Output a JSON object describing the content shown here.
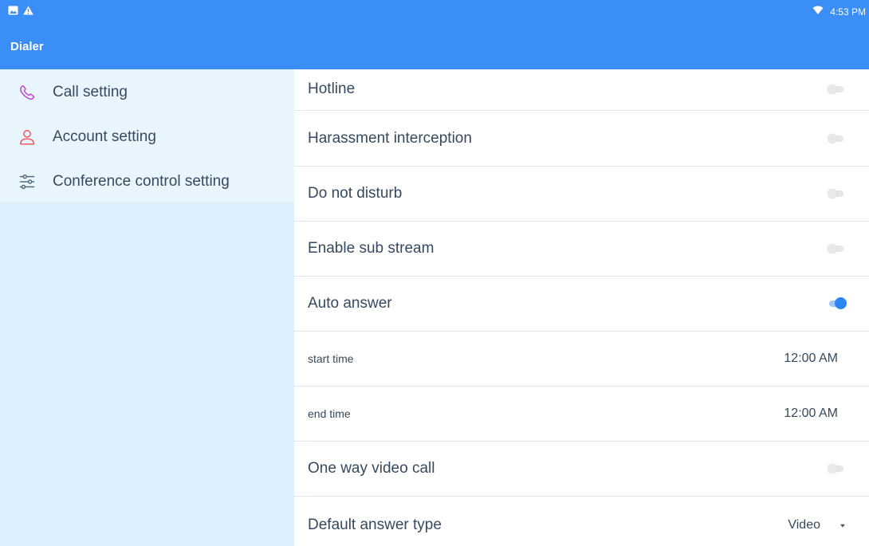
{
  "status_bar": {
    "time": "4:53 PM"
  },
  "app_bar": {
    "title": "Dialer"
  },
  "sidebar": {
    "items": [
      {
        "label": "Call setting",
        "icon": "phone-icon"
      },
      {
        "label": "Account setting",
        "icon": "person-icon"
      },
      {
        "label": "Conference control setting",
        "icon": "sliders-icon"
      }
    ]
  },
  "settings": {
    "hotline": {
      "label": "Hotline",
      "enabled": false
    },
    "harassment": {
      "label": "Harassment interception",
      "enabled": false
    },
    "dnd": {
      "label": "Do not disturb",
      "enabled": false
    },
    "sub_stream": {
      "label": "Enable sub stream",
      "enabled": false
    },
    "auto_answer": {
      "label": "Auto answer",
      "enabled": true
    },
    "start_time": {
      "label": "start time",
      "value": "12:00 AM"
    },
    "end_time": {
      "label": "end time",
      "value": "12:00 AM"
    },
    "one_way_video": {
      "label": "One way video call",
      "enabled": false
    },
    "default_answer": {
      "label": "Default answer type",
      "value": "Video"
    }
  },
  "colors": {
    "primary": "#3a8ef6",
    "toggle_on": "#2a86f3",
    "phone_icon": "#c23fd9",
    "person_icon": "#f2575f",
    "sliders_icon": "#4c6278",
    "text": "#36495e"
  }
}
